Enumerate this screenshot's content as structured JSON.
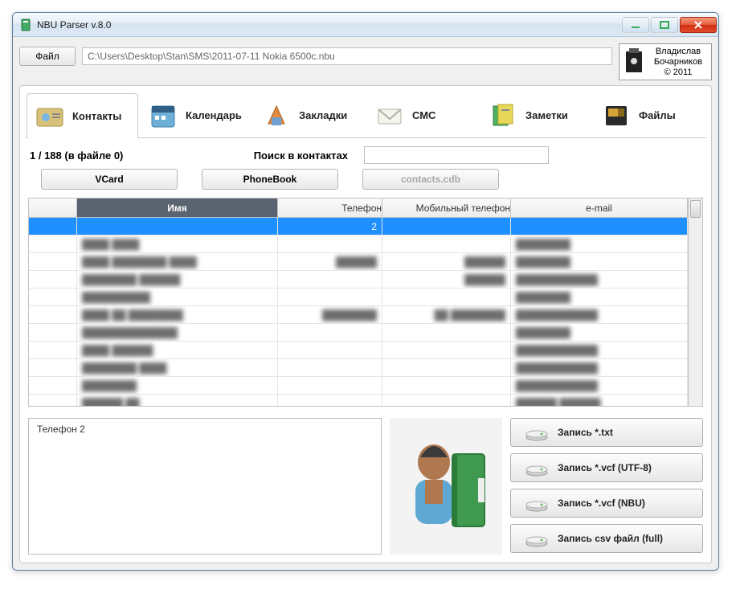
{
  "window": {
    "title": "NBU Parser v.8.0"
  },
  "menu": {
    "file_label": "Файл"
  },
  "path": {
    "value": "C:\\Users\\Desktop\\Stan\\SMS\\2011-07-11 Nokia 6500c.nbu"
  },
  "branding": {
    "line1": "Владислав",
    "line2": "Бочарников",
    "line3": "© 2011"
  },
  "categories": [
    {
      "label": "Контакты",
      "icon": "contacts"
    },
    {
      "label": "Календарь",
      "icon": "calendar"
    },
    {
      "label": "Закладки",
      "icon": "bookmarks"
    },
    {
      "label": "СМС",
      "icon": "sms"
    },
    {
      "label": "Заметки",
      "icon": "notes"
    },
    {
      "label": "Файлы",
      "icon": "files"
    }
  ],
  "status": {
    "count_text": "1 / 188 (в файле 0)",
    "search_label": "Поиск в контактах"
  },
  "search": {
    "value": ""
  },
  "subtabs": {
    "vcard": "VCard",
    "phonebook": "PhoneBook",
    "contactsdb": "contacts.cdb"
  },
  "grid": {
    "headers": {
      "name": "Имя",
      "phone": "Телефон",
      "mobile": "Мобильный телефон",
      "email": "e-mail"
    },
    "rows": [
      {
        "name": "",
        "phone": "2",
        "mobile": "",
        "email": "",
        "selected": true,
        "blur": false
      },
      {
        "name": "████ ████",
        "phone": "",
        "mobile": "",
        "email": "████████",
        "blur": true
      },
      {
        "name": "████ ████████ ████",
        "phone": "██████",
        "mobile": "██████",
        "email": "████████",
        "blur": true
      },
      {
        "name": "████████ ██████",
        "phone": "",
        "mobile": "██████",
        "email": "████████████",
        "blur": true
      },
      {
        "name": "██████████",
        "phone": "",
        "mobile": "",
        "email": "████████",
        "blur": true
      },
      {
        "name": "████ ██ ████████",
        "phone": "████████",
        "mobile": "██ ████████",
        "email": "████████████",
        "blur": true
      },
      {
        "name": "██████████████",
        "phone": "",
        "mobile": "",
        "email": "████████",
        "blur": true
      },
      {
        "name": "████ ██████",
        "phone": "",
        "mobile": "",
        "email": "████████████",
        "blur": true
      },
      {
        "name": "████████ ████",
        "phone": "",
        "mobile": "",
        "email": "████████████",
        "blur": true
      },
      {
        "name": "████████",
        "phone": "",
        "mobile": "",
        "email": "████████████",
        "blur": true
      },
      {
        "name": "██████ ██",
        "phone": "",
        "mobile": "",
        "email": "██████ ██████",
        "blur": true
      },
      {
        "name": "██████████ ████████ ████████",
        "phone": "",
        "mobile": "",
        "email": "████████████████",
        "blur": true
      }
    ]
  },
  "detail": {
    "text": "Телефон   2"
  },
  "export": {
    "txt": "Запись *.txt",
    "vcf_utf8": "Запись *.vcf (UTF-8)",
    "vcf_nbu": "Запись *.vcf (NBU)",
    "csv": "Запись csv файл (full)"
  }
}
